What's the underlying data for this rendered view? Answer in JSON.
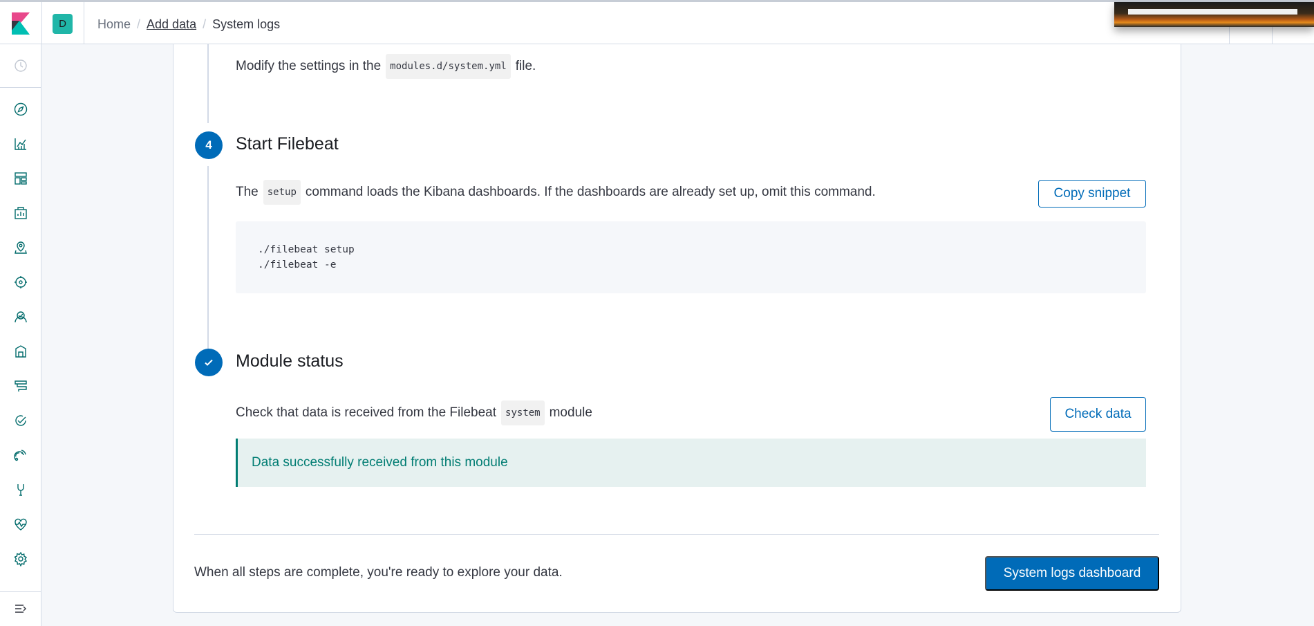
{
  "header": {
    "space_initial": "D",
    "breadcrumbs": [
      "Home",
      "Add data",
      "System logs"
    ]
  },
  "sidebar": {
    "items": [
      "recently-viewed",
      "discover",
      "visualize",
      "dashboard",
      "canvas",
      "maps",
      "machine-learning",
      "infrastructure",
      "logs",
      "apm",
      "uptime",
      "siem",
      "dev-tools",
      "monitoring",
      "management"
    ],
    "collapse": "collapse-menu"
  },
  "main": {
    "step3": {
      "text_before": "Modify the settings in the",
      "code": "modules.d/system.yml",
      "text_after": "file."
    },
    "step4": {
      "number": "4",
      "title": "Start Filebeat",
      "text_before": "The",
      "code": "setup",
      "text_after": "command loads the Kibana dashboards. If the dashboards are already set up, omit this command.",
      "copy_button": "Copy snippet",
      "code_lines": [
        "./filebeat setup",
        "./filebeat -e"
      ]
    },
    "status": {
      "title": "Module status",
      "text_before": "Check that data is received from the Filebeat",
      "code": "system",
      "text_after": "module",
      "check_button": "Check data",
      "callout": "Data successfully received from this module"
    },
    "footer": {
      "text": "When all steps are complete, you're ready to explore your data.",
      "dashboard_button": "System logs dashboard"
    }
  },
  "colors": {
    "primary": "#006bb8",
    "success": "#017d73",
    "success_bg": "#e6f1f0",
    "space_avatar": "#20b6a8"
  }
}
